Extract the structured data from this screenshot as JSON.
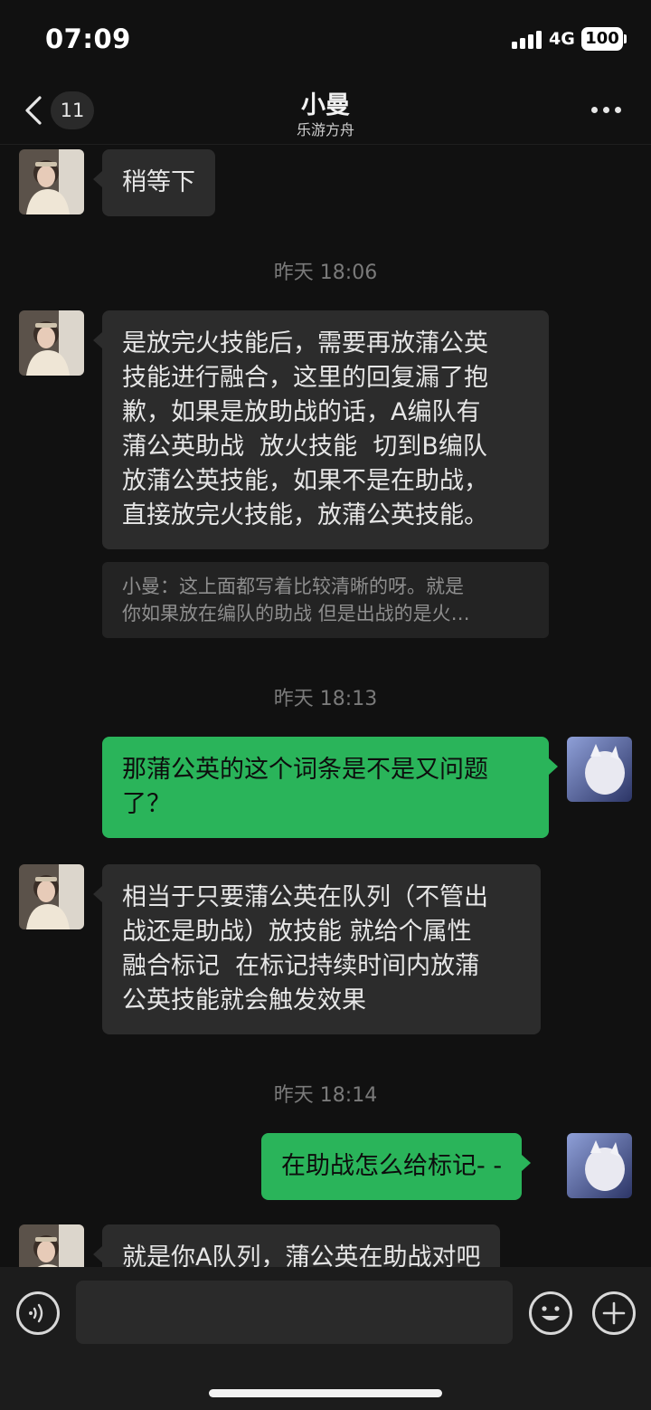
{
  "status_bar": {
    "time": "07:09",
    "network": "4G",
    "battery": "100"
  },
  "nav": {
    "unread_count": "11",
    "title": "小曼",
    "subtitle": "乐游方舟"
  },
  "messages": [
    {
      "text": "稍等下"
    },
    {
      "text": "是放完火技能后，需要再放蒲公英\n技能进行融合，这里的回复漏了抱\n歉，如果是放助战的话，A编队有\n蒲公英助战  放火技能  切到B编队\n放蒲公英技能，如果不是在助战，\n直接放完火技能，放蒲公英技能。"
    },
    {
      "text": "那蒲公英的这个词条是不是又问题\n了？"
    },
    {
      "text": "相当于只要蒲公英在队列（不管出\n战还是助战）放技能 就给个属性\n融合标记  在标记持续时间内放蒲\n公英技能就会触发效果"
    },
    {
      "text": "在助战怎么给标记- -"
    },
    {
      "text": "就是你A队列，蒲公英在助战对吧"
    }
  ],
  "timestamps": [
    "昨天 18:06",
    "昨天 18:13",
    "昨天 18:14"
  ],
  "quote": {
    "text": "小曼：这上面都写着比较清晰的呀。就是\n你如果放在编队的助战 但是出战的是火…"
  },
  "colors": {
    "background": "#111111",
    "incoming_bubble": "#2c2c2c",
    "outgoing_bubble": "#2ab45a"
  },
  "icons": [
    "back-arrow-icon",
    "more-icon",
    "voice-icon",
    "emoji-icon",
    "plus-icon"
  ]
}
